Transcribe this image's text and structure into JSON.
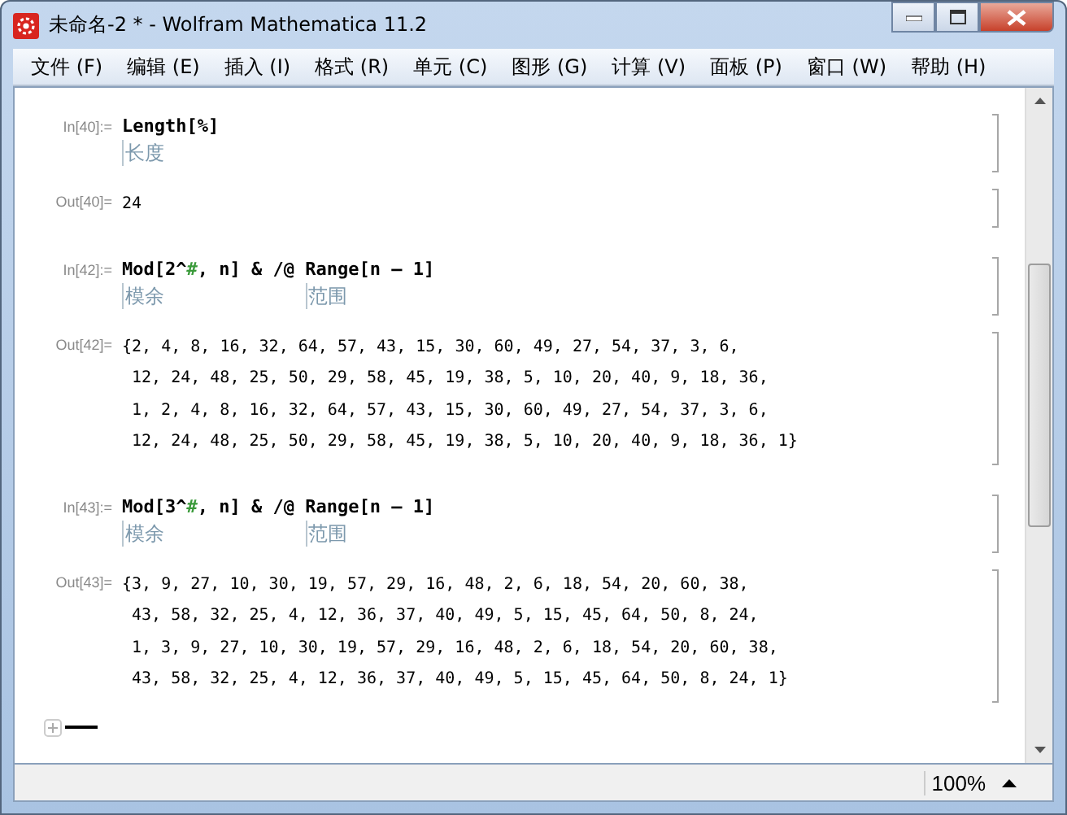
{
  "window": {
    "title": "未命名-2 * - Wolfram Mathematica 11.2"
  },
  "menu": [
    "文件 (F)",
    "编辑 (E)",
    "插入 (I)",
    "格式 (R)",
    "单元 (C)",
    "图形 (G)",
    "计算 (V)",
    "面板 (P)",
    "窗口 (W)",
    "帮助 (H)"
  ],
  "cells": [
    {
      "kind": "input",
      "label": "In[40]:=",
      "segments": [
        {
          "kind": "code",
          "text": "Length[%]",
          "hint": "长度"
        }
      ]
    },
    {
      "kind": "output",
      "label": "Out[40]=",
      "lines": [
        "24"
      ]
    },
    {
      "kind": "input",
      "label": "In[42]:=",
      "segments": [
        {
          "kind": "code",
          "text": "Mod[2^",
          "hint": "模余"
        },
        {
          "kind": "slot",
          "text": "#"
        },
        {
          "kind": "code",
          "text": ", n] & /@ "
        },
        {
          "kind": "code",
          "text": "Range[n – 1]",
          "hint": "范围"
        }
      ]
    },
    {
      "kind": "output",
      "label": "Out[42]=",
      "lines": [
        "{2, 4, 8, 16, 32, 64, 57, 43, 15, 30, 60, 49, 27, 54, 37, 3, 6,",
        "12, 24, 48, 25, 50, 29, 58, 45, 19, 38, 5, 10, 20, 40, 9, 18, 36,",
        "1, 2, 4, 8, 16, 32, 64, 57, 43, 15, 30, 60, 49, 27, 54, 37, 3, 6,",
        "12, 24, 48, 25, 50, 29, 58, 45, 19, 38, 5, 10, 20, 40, 9, 18, 36, 1}"
      ]
    },
    {
      "kind": "input",
      "label": "In[43]:=",
      "segments": [
        {
          "kind": "code",
          "text": "Mod[3^",
          "hint": "模余"
        },
        {
          "kind": "slot",
          "text": "#"
        },
        {
          "kind": "code",
          "text": ", n] & /@ "
        },
        {
          "kind": "code",
          "text": "Range[n – 1]",
          "hint": "范围"
        }
      ]
    },
    {
      "kind": "output",
      "label": "Out[43]=",
      "lines": [
        "{3, 9, 27, 10, 30, 19, 57, 29, 16, 48, 2, 6, 18, 54, 20, 60, 38,",
        "43, 58, 32, 25, 4, 12, 36, 37, 40, 49, 5, 15, 45, 64, 50, 8, 24,",
        "1, 3, 9, 27, 10, 30, 19, 57, 29, 16, 48, 2, 6, 18, 54, 20, 60, 38,",
        "43, 58, 32, 25, 4, 12, 36, 37, 40, 49, 5, 15, 45, 64, 50, 8, 24, 1}"
      ]
    }
  ],
  "status_bar": {
    "zoom": "100%"
  }
}
